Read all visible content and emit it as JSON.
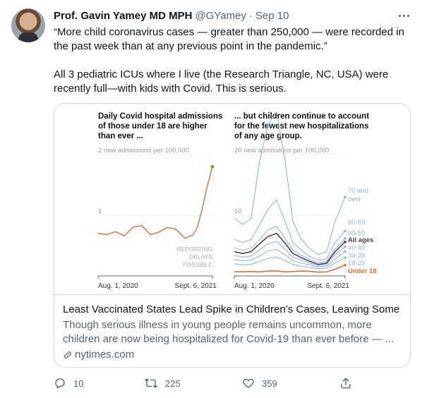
{
  "tweet": {
    "author_name": "Prof. Gavin Yamey MD MPH",
    "handle": "@GYamey",
    "separator": "·",
    "date": "Sep 10",
    "text_paragraphs": [
      "“More child coronavirus cases — greater than 250,000 — were recorded in the past week than at any previous point in the pandemic.”",
      "All 3 pediatric ICUs where I live (the Research Triangle, NC, USA) were recently full—with kids with Covid. This is serious."
    ]
  },
  "card": {
    "title": "Least Vaccinated States Lead Spike in Children’s Cases, Leaving Some ...",
    "description": "Though serious illness in young people remains uncommon, more children are now being hospitalized for Covid-19 than ever before — ...",
    "domain": "nytimes.com"
  },
  "actions": {
    "replies": "10",
    "retweets": "225",
    "likes": "359"
  },
  "colors": {
    "under18": "#e8683a",
    "ages_series": "#8fb7c9",
    "all_ages": "#4e3b5c",
    "grid": "#d0d0d0"
  },
  "chart_data": [
    {
      "type": "line",
      "title_lines": [
        "Daily Covid hospital admissions",
        "of those under 18 are higher",
        "than ever ..."
      ],
      "ylabel": "2 new admissions per 100,000",
      "y_ticks": [
        "2 new admissions per 100,000",
        "1"
      ],
      "ylim": [
        0,
        2
      ],
      "x_tick_labels": [
        "Aug. 1, 2020",
        "Sept. 6, 2021"
      ],
      "annotation_lines": [
        "REPORTING",
        "DELAYS",
        "POSSIBLE"
      ],
      "series": [
        {
          "name": "Under 18",
          "x": [
            "2020-08-01",
            "2020-09-01",
            "2020-10-01",
            "2020-11-01",
            "2020-12-01",
            "2021-01-01",
            "2021-02-01",
            "2021-03-01",
            "2021-04-01",
            "2021-05-01",
            "2021-06-01",
            "2021-07-01",
            "2021-07-15",
            "2021-08-01",
            "2021-08-15",
            "2021-09-06"
          ],
          "values": [
            0.7,
            0.68,
            0.73,
            0.66,
            0.8,
            0.83,
            0.68,
            0.72,
            0.8,
            0.77,
            0.62,
            0.68,
            0.8,
            1.1,
            1.4,
            1.8
          ]
        }
      ]
    },
    {
      "type": "line",
      "title_lines": [
        "... but children continue to account",
        "for the fewest new hospitalizations",
        "of any age group."
      ],
      "ylabel": "20 new admissions per 100,000",
      "y_ticks": [
        "20 new admissions per 100,000",
        "10"
      ],
      "ylim": [
        0,
        20
      ],
      "x_tick_labels": [
        "Aug. 1, 2020",
        "Sept. 6, 2021"
      ],
      "x": [
        "2020-08-01",
        "2020-09-01",
        "2020-10-01",
        "2020-11-01",
        "2020-12-01",
        "2021-01-01",
        "2021-02-01",
        "2021-03-01",
        "2021-04-01",
        "2021-05-01",
        "2021-06-01",
        "2021-07-01",
        "2021-08-01",
        "2021-09-06"
      ],
      "series": [
        {
          "name": "70 and over",
          "values": [
            9.5,
            8.5,
            9.5,
            19,
            25,
            27,
            19,
            9,
            6,
            4.5,
            3.5,
            4,
            9,
            13
          ]
        },
        {
          "name": "60-69",
          "values": [
            6,
            5.5,
            6,
            8.5,
            11,
            12.5,
            9,
            5.5,
            4.2,
            3.2,
            2.6,
            2.8,
            5.5,
            7.4
          ]
        },
        {
          "name": "50-59",
          "values": [
            4.6,
            4.2,
            4.6,
            6,
            7.6,
            8.2,
            6.2,
            4.2,
            3.4,
            2.7,
            2.2,
            2.4,
            4.4,
            6.2
          ]
        },
        {
          "name": "All ages",
          "values": [
            4.0,
            3.7,
            4.0,
            5.3,
            6.5,
            7.0,
            5.4,
            3.7,
            3.0,
            2.4,
            1.9,
            2.1,
            4.0,
            5.6
          ]
        },
        {
          "name": "40-49",
          "values": [
            3.4,
            3.1,
            3.3,
            4.3,
            5.3,
            5.7,
            4.4,
            3.1,
            2.6,
            2.1,
            1.7,
            1.9,
            3.5,
            4.8
          ]
        },
        {
          "name": "30-39",
          "values": [
            2.7,
            2.5,
            2.6,
            3.3,
            4.1,
            4.4,
            3.5,
            2.5,
            2.1,
            1.8,
            1.5,
            1.6,
            2.8,
            4.0
          ]
        },
        {
          "name": "18-29",
          "values": [
            2.0,
            1.8,
            1.9,
            2.4,
            2.9,
            3.1,
            2.5,
            1.9,
            1.6,
            1.4,
            1.2,
            1.3,
            2.1,
            3.0
          ]
        },
        {
          "name": "Under 18",
          "values": [
            0.7,
            0.68,
            0.73,
            0.66,
            0.8,
            0.83,
            0.68,
            0.72,
            0.8,
            0.77,
            0.62,
            0.68,
            1.1,
            1.8
          ]
        }
      ]
    }
  ]
}
